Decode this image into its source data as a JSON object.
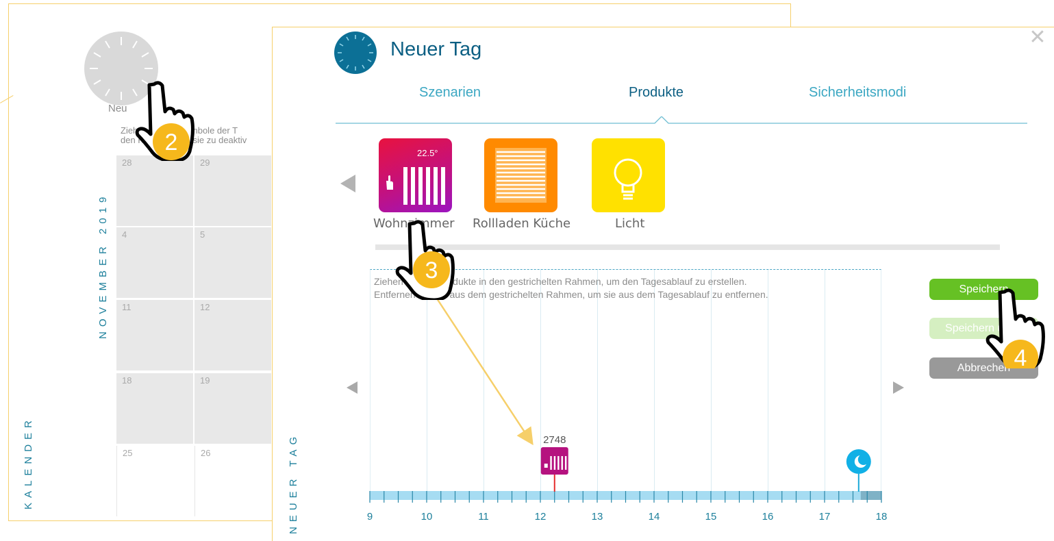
{
  "calendar": {
    "new_label": "Neu",
    "hint_line1": "Ziehen Sie die Symbole der T",
    "hint_line2": "den Kalender, um sie zu deaktiv",
    "month_label": "NOVEMBER 2019",
    "side_label": "KALENDER",
    "days": [
      [
        "28",
        "29"
      ],
      [
        "4",
        "5"
      ],
      [
        "11",
        "12"
      ],
      [
        "18",
        "19"
      ],
      [
        "25",
        "26"
      ]
    ]
  },
  "modal": {
    "title": "Neuer Tag",
    "close_symbol": "✕",
    "tabs": [
      {
        "label": "Szenarien",
        "active": false
      },
      {
        "label": "Produkte",
        "active": true
      },
      {
        "label": "Sicherheitsmodi",
        "active": false
      }
    ],
    "products": [
      {
        "name": "Wohnzimmer",
        "icon": "radiator-icon",
        "temperature": "22.5°",
        "color_from": "#e8123f",
        "color_to": "#9b15c0"
      },
      {
        "name": "Rollladen Küche",
        "icon": "roller-shutter-icon",
        "color": "#ff8a00"
      },
      {
        "name": "Licht",
        "icon": "light-bulb-icon",
        "color": "#ffe100"
      }
    ],
    "timeline": {
      "hint_line1": "Ziehen Sie die Produkte in den gestrichelten Rahmen, um den Tagesablauf zu erstellen.",
      "hint_line2": "Entfernen Sie sie aus dem gestrichelten Rahmen, um sie aus dem Tagesablauf zu entfernen.",
      "hours": [
        "9",
        "10",
        "11",
        "12",
        "13",
        "14",
        "15",
        "16",
        "17",
        "18"
      ],
      "event": {
        "label": "2748",
        "time_hours": 12.25,
        "icon": "radiator-icon"
      },
      "night_marker": {
        "icon": "moon-icon",
        "time_hours": 17.6
      },
      "side_label": "NEUER TAG"
    },
    "buttons": {
      "save": "Speichern",
      "save_as": "Speichern unter",
      "cancel": "Abbrechen"
    }
  },
  "steps": [
    "2",
    "3",
    "4"
  ],
  "colors": {
    "accent_teal": "#0c5f83",
    "tab_inactive": "#3ba7c2",
    "panel_border": "#f6cf6a",
    "save_green": "#66c124",
    "step_badge": "#f6b81c"
  }
}
